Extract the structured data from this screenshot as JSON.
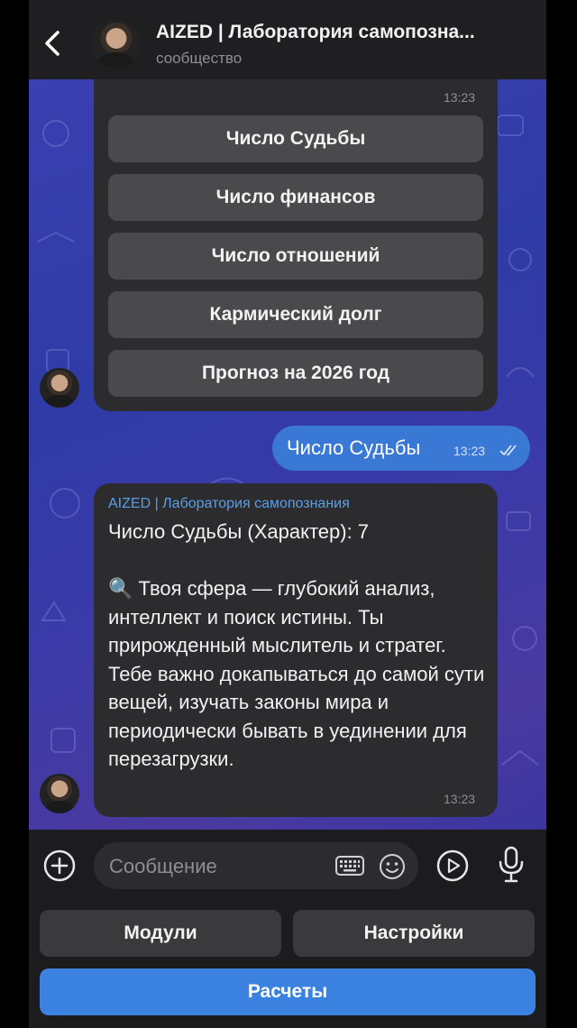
{
  "header": {
    "title": "AIZED | Лаборатория самопозна...",
    "subtitle": "сообщество"
  },
  "keyboard_message": {
    "time": "13:23",
    "buttons": [
      "Число Судьбы",
      "Число финансов",
      "Число отношений",
      "Кармический долг",
      "Прогноз на 2026 год"
    ]
  },
  "outgoing_message": {
    "text": "Число Судьбы",
    "time": "13:23"
  },
  "incoming_message": {
    "sender": "AIZED | Лаборатория самопознания",
    "text": "Число Судьбы (Характер): 7\n\n🔍 Твоя сфера — глубокий анализ, интеллект и поиск истины. Ты прирожденный мыслитель и стратег. Тебе важно докапываться до самой сути вещей, изучать законы мира и периодически бывать в уединении для перезагрузки.",
    "time": "13:23"
  },
  "input": {
    "placeholder": "Сообщение"
  },
  "reply_keyboard": {
    "left": "Модули",
    "right": "Настройки",
    "bottom": "Расчеты"
  },
  "colors": {
    "accent": "#3b82e0",
    "bubble_out": "#3a78d6",
    "bubble_in": "#2c2c2e",
    "sender_name": "#5a9fe6"
  }
}
